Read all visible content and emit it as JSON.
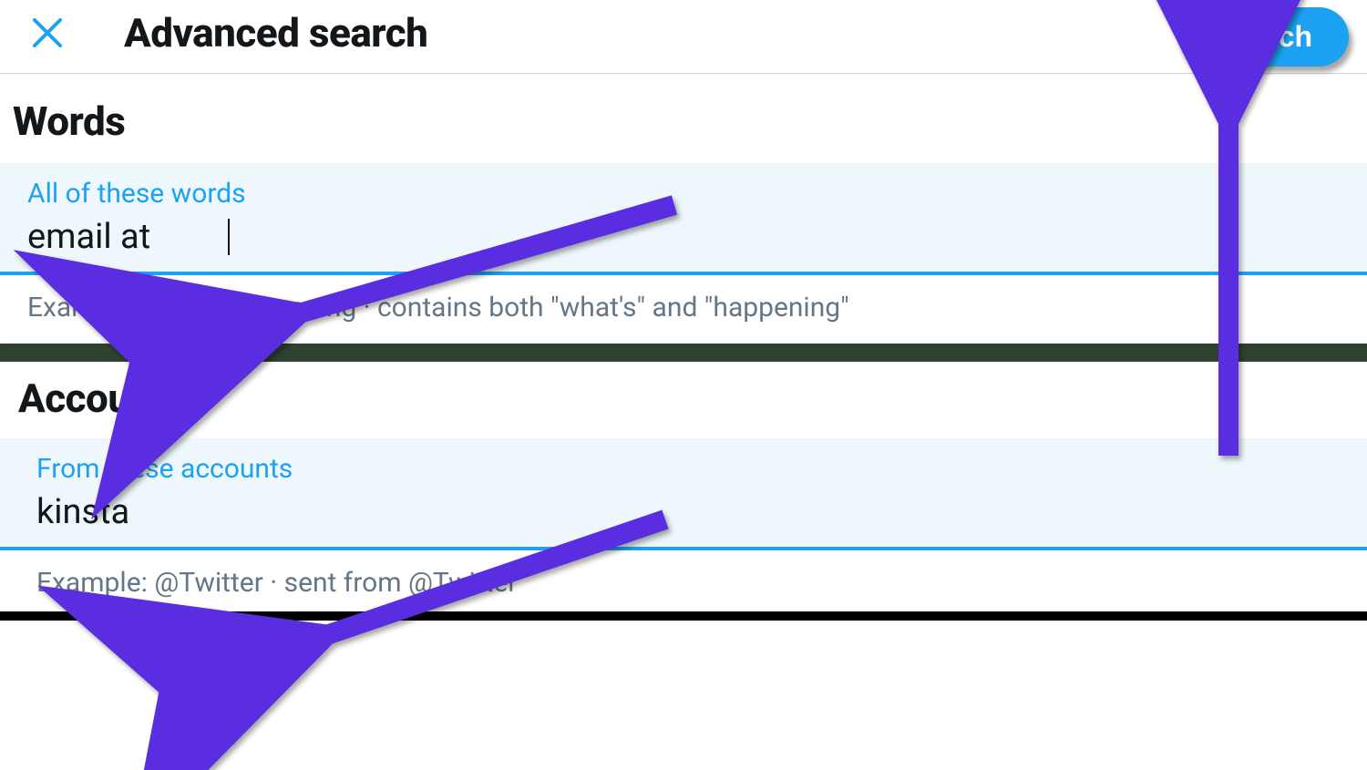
{
  "header": {
    "title": "Advanced search",
    "search_button_label": "Search",
    "close_icon": "close-icon"
  },
  "sections": {
    "words": {
      "heading": "Words",
      "field": {
        "label": "All of these words",
        "value": "email at",
        "example": "Example: what's happening · contains both \"what's\" and \"happening\""
      }
    },
    "accounts": {
      "heading": "Accounts",
      "field": {
        "label": "From these accounts",
        "value": "kinsta",
        "example": "Example: @Twitter · sent from @Twitter"
      }
    }
  },
  "colors": {
    "accent": "#1da1f2",
    "annotation_arrow": "#5a2ee0"
  }
}
